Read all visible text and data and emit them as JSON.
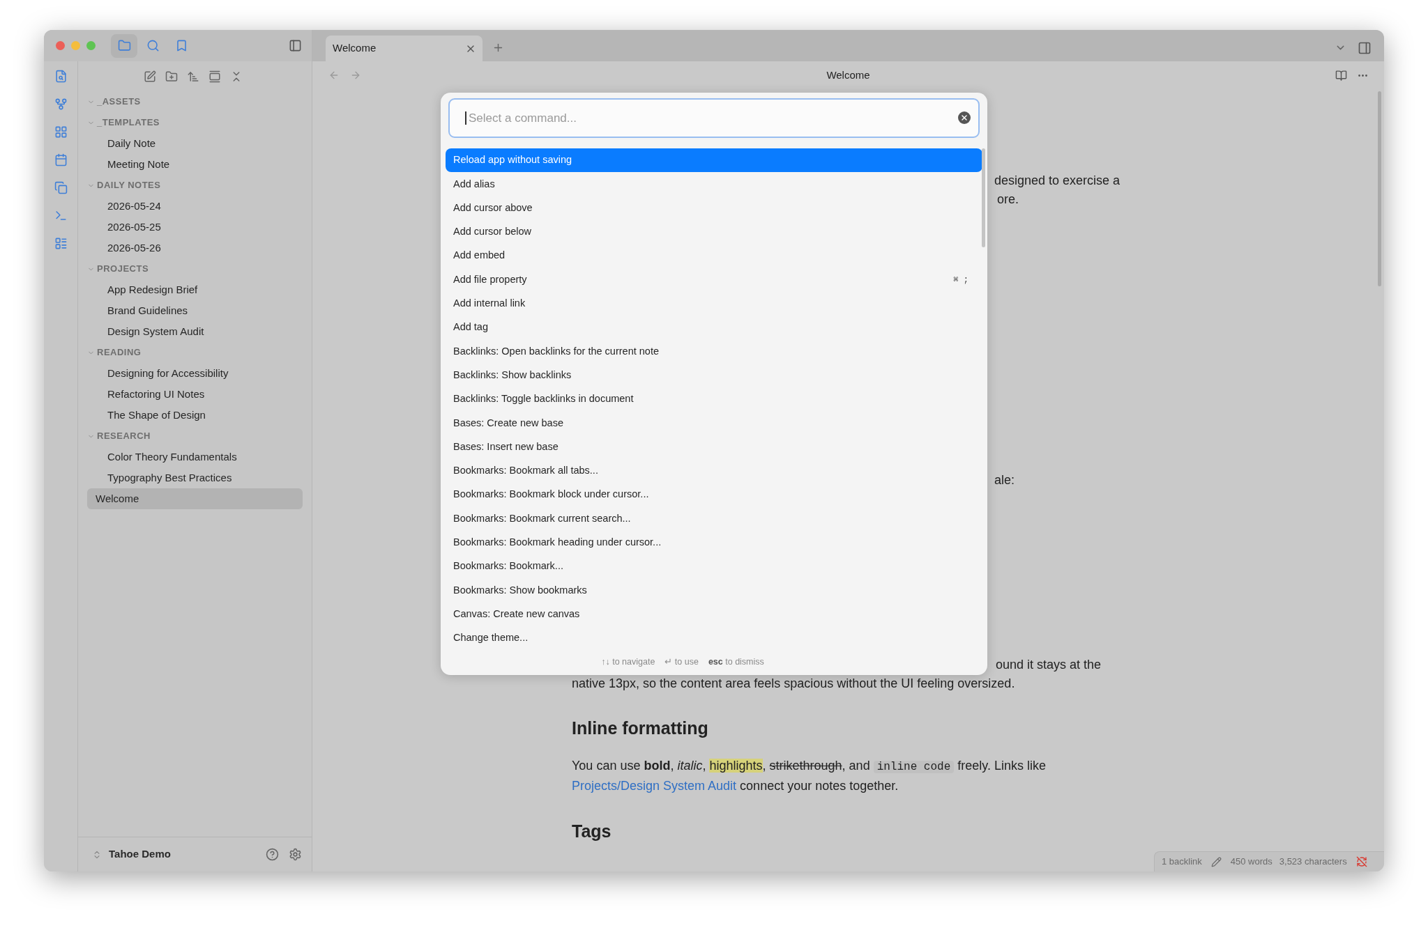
{
  "sidebar_tabs": [
    {
      "kind": "files",
      "selected": true
    },
    {
      "kind": "search",
      "selected": false
    },
    {
      "kind": "bookmarks",
      "selected": false
    }
  ],
  "sidebar": {
    "tree": [
      {
        "kind": "folder",
        "label": "_ASSETS",
        "expanded": true,
        "selected": false
      },
      {
        "kind": "folder",
        "label": "_TEMPLATES",
        "expanded": true,
        "selected": false,
        "children": [
          {
            "kind": "file",
            "label": "Daily Note",
            "selected": false
          },
          {
            "kind": "file",
            "label": "Meeting Note",
            "selected": false
          }
        ]
      },
      {
        "kind": "folder",
        "label": "DAILY NOTES",
        "expanded": true,
        "selected": false,
        "children": [
          {
            "kind": "file",
            "label": "2026-05-24",
            "selected": false
          },
          {
            "kind": "file",
            "label": "2026-05-25",
            "selected": false
          },
          {
            "kind": "file",
            "label": "2026-05-26",
            "selected": false
          }
        ]
      },
      {
        "kind": "folder",
        "label": "PROJECTS",
        "expanded": true,
        "selected": false,
        "children": [
          {
            "kind": "file",
            "label": "App Redesign Brief",
            "selected": false
          },
          {
            "kind": "file",
            "label": "Brand Guidelines",
            "selected": false
          },
          {
            "kind": "file",
            "label": "Design System Audit",
            "selected": false
          }
        ]
      },
      {
        "kind": "folder",
        "label": "READING",
        "expanded": true,
        "selected": false,
        "children": [
          {
            "kind": "file",
            "label": "Designing for Accessibility",
            "selected": false
          },
          {
            "kind": "file",
            "label": "Refactoring UI Notes",
            "selected": false
          },
          {
            "kind": "file",
            "label": "The Shape of Design",
            "selected": false
          }
        ]
      },
      {
        "kind": "folder",
        "label": "RESEARCH",
        "expanded": true,
        "selected": false,
        "children": [
          {
            "kind": "file",
            "label": "Color Theory Fundamentals",
            "selected": false
          },
          {
            "kind": "file",
            "label": "Typography Best Practices",
            "selected": false
          }
        ]
      },
      {
        "kind": "file",
        "label": "Welcome",
        "selected": true
      }
    ],
    "vault": "Tahoe Demo"
  },
  "tabs": [
    {
      "label": "Welcome",
      "selected": true
    }
  ],
  "view_title": "Welcome",
  "editor": {
    "lines_1": [
      "designed to exercise a",
      "ore."
    ],
    "line_2": "ale:",
    "lines_3": [
      "ound it stays at the",
      "native 13px, so the content area feels spacious without the UI feeling oversized."
    ],
    "heading_1": "Inline formatting",
    "paragraph": [
      {
        "kind": "text",
        "text": "You can use "
      },
      {
        "kind": "bold",
        "text": "bold"
      },
      {
        "kind": "text",
        "text": ", "
      },
      {
        "kind": "italic",
        "text": "italic"
      },
      {
        "kind": "text",
        "text": ", "
      },
      {
        "kind": "highlight",
        "text": "highlights"
      },
      {
        "kind": "text",
        "text": ", "
      },
      {
        "kind": "strike",
        "text": "strikethrough"
      },
      {
        "kind": "text",
        "text": ", and "
      },
      {
        "kind": "code",
        "text": "inline code"
      },
      {
        "kind": "text",
        "text": " freely. Links like "
      },
      {
        "kind": "link",
        "text": "Projects/Design System Audit"
      },
      {
        "kind": "text",
        "text": " connect your notes together."
      }
    ],
    "heading_2": "Tags"
  },
  "command_palette": {
    "placeholder": "Select a command...",
    "commands": [
      {
        "label": "Reload app without saving",
        "selected": true
      },
      {
        "label": "Add alias",
        "selected": false
      },
      {
        "label": "Add cursor above",
        "selected": false
      },
      {
        "label": "Add cursor below",
        "selected": false
      },
      {
        "label": "Add embed",
        "selected": false
      },
      {
        "label": "Add file property",
        "selected": false,
        "shortcut": "⌘ ;"
      },
      {
        "label": "Add internal link",
        "selected": false
      },
      {
        "label": "Add tag",
        "selected": false
      },
      {
        "label": "Backlinks: Open backlinks for the current note",
        "selected": false
      },
      {
        "label": "Backlinks: Show backlinks",
        "selected": false
      },
      {
        "label": "Backlinks: Toggle backlinks in document",
        "selected": false
      },
      {
        "label": "Bases: Create new base",
        "selected": false
      },
      {
        "label": "Bases: Insert new base",
        "selected": false
      },
      {
        "label": "Bookmarks: Bookmark all tabs...",
        "selected": false
      },
      {
        "label": "Bookmarks: Bookmark block under cursor...",
        "selected": false
      },
      {
        "label": "Bookmarks: Bookmark current search...",
        "selected": false
      },
      {
        "label": "Bookmarks: Bookmark heading under cursor...",
        "selected": false
      },
      {
        "label": "Bookmarks: Bookmark...",
        "selected": false
      },
      {
        "label": "Bookmarks: Show bookmarks",
        "selected": false
      },
      {
        "label": "Canvas: Create new canvas",
        "selected": false
      },
      {
        "label": "Change theme...",
        "selected": false
      }
    ],
    "hints": [
      {
        "keys": "↑↓",
        "label": "to navigate"
      },
      {
        "keys": "↵",
        "label": "to use"
      },
      {
        "keys": "esc",
        "label": "to dismiss"
      }
    ]
  },
  "status_bar": {
    "backlinks": "1 backlink",
    "words": "450 words",
    "characters": "3,523 characters"
  }
}
